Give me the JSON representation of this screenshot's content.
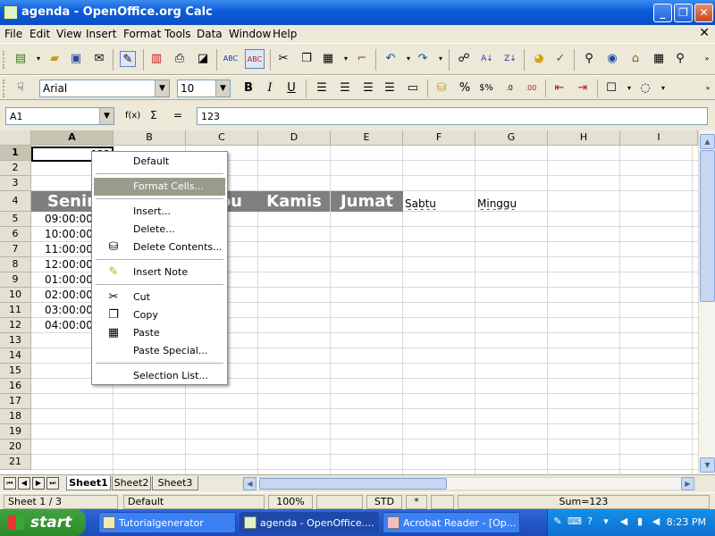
{
  "window": {
    "title": "agenda - OpenOffice.org Calc",
    "close_doc_glyph": "✕"
  },
  "menu": [
    "File",
    "Edit",
    "View",
    "Insert",
    "Format",
    "Tools",
    "Data",
    "Window",
    "Help"
  ],
  "format_toolbar": {
    "font_name": "Arial",
    "font_size": "10"
  },
  "formula_bar": {
    "cell_ref": "A1",
    "fx": "f(x)",
    "sum": "Σ",
    "equals": "=",
    "content": "123"
  },
  "columns": [
    "A",
    "B",
    "C",
    "D",
    "E",
    "F",
    "G",
    "H",
    "I"
  ],
  "rows": [
    "1",
    "2",
    "3",
    "4",
    "5",
    "6",
    "7",
    "8",
    "9",
    "10",
    "11",
    "12",
    "13",
    "14",
    "15",
    "16",
    "17",
    "18",
    "19",
    "20",
    "21"
  ],
  "sheet": {
    "a1_value": "123",
    "day_headers": [
      "Senin",
      "Rabu",
      "Kamis",
      "Jumat"
    ],
    "day_plain": [
      "Sabtu",
      "Minggu"
    ],
    "times": [
      "09:00:00",
      "10:00:00",
      "11:00:00",
      "12:00:00",
      "01:00:00",
      "02:00:00",
      "03:00:00",
      "04:00:00"
    ]
  },
  "context_menu": {
    "items": [
      {
        "label": "Default"
      },
      {
        "label": "Format Cells..."
      },
      {
        "label": "Insert..."
      },
      {
        "label": "Delete..."
      },
      {
        "label": "Delete Contents..."
      },
      {
        "label": "Insert Note"
      },
      {
        "label": "Cut"
      },
      {
        "label": "Copy"
      },
      {
        "label": "Paste"
      },
      {
        "label": "Paste Special..."
      },
      {
        "label": "Selection List..."
      }
    ]
  },
  "tabs": [
    "Sheet1",
    "Sheet2",
    "Sheet3"
  ],
  "status": {
    "sheet": "Sheet 1 / 3",
    "style": "Default",
    "zoom": "100%",
    "mode": "STD",
    "mod": "*",
    "sum": "Sum=123"
  },
  "taskbar": {
    "start": "start",
    "tasks": [
      "Tutorialgenerator",
      "agenda - OpenOffice....",
      "Acrobat Reader - [Op..."
    ],
    "clock": "8:23 PM"
  },
  "colors": {
    "header_cell_bg": "#7f7f7f",
    "highlight": "#9b9b8b",
    "xp_blue": "#2456c7"
  }
}
